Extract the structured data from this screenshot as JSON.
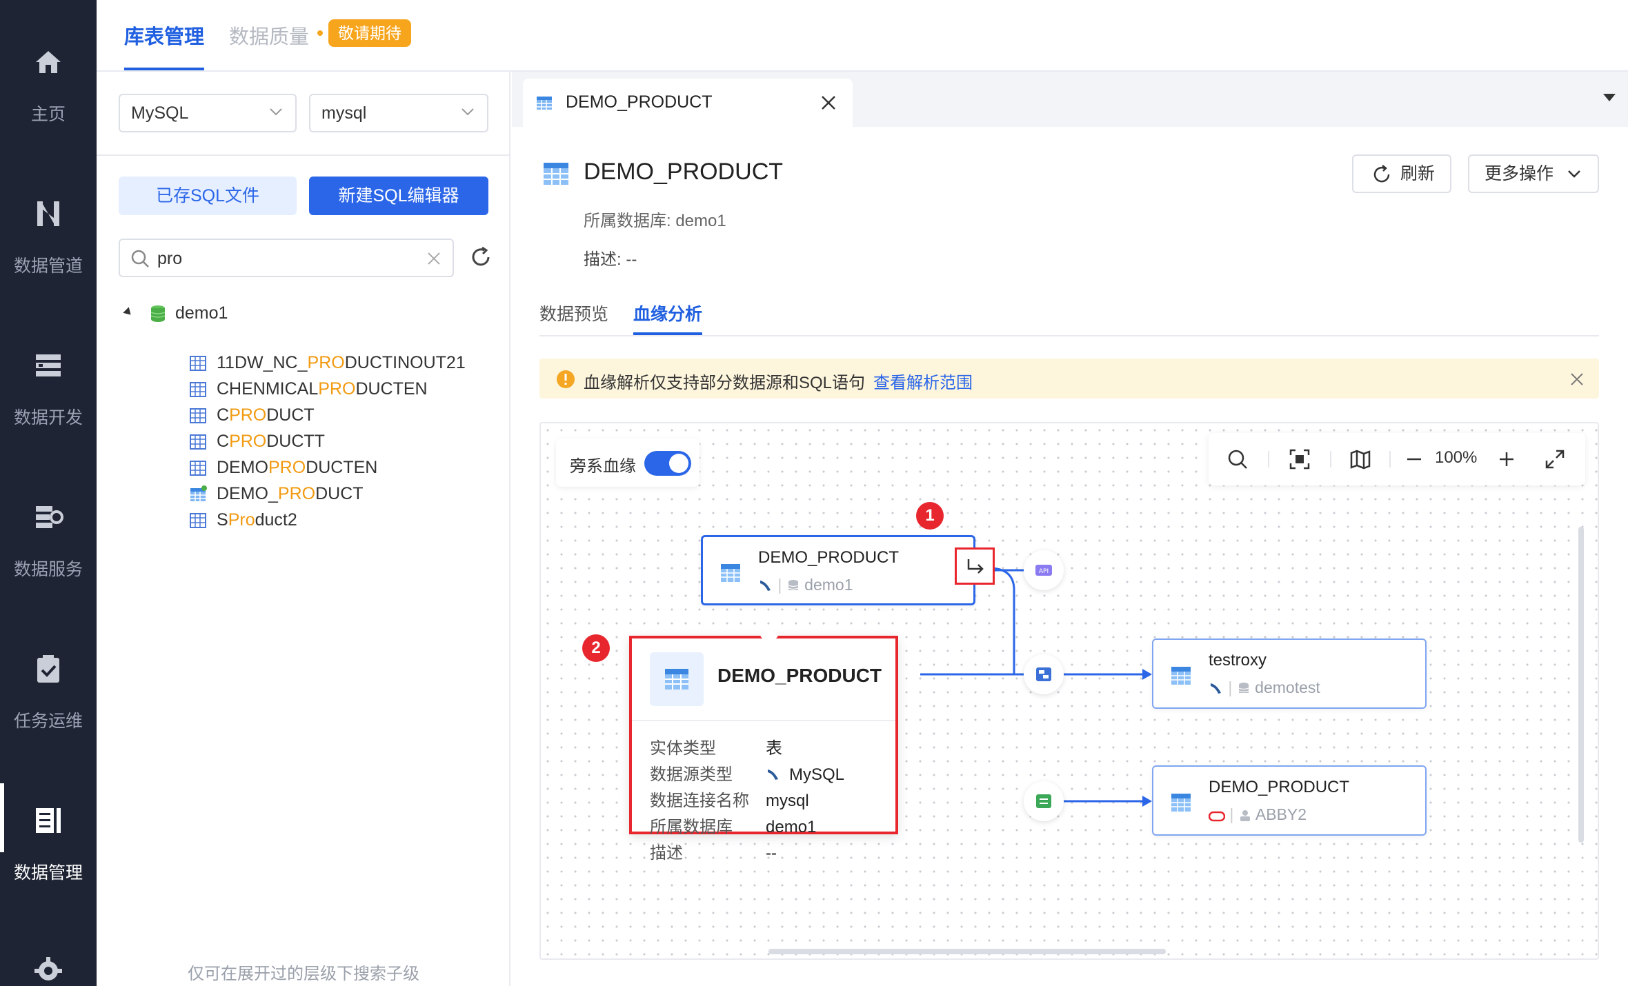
{
  "nav": {
    "items": [
      {
        "label": "主页",
        "icon": "home-icon"
      },
      {
        "label": "数据管道",
        "icon": "pipeline-icon"
      },
      {
        "label": "数据开发",
        "icon": "dev-icon"
      },
      {
        "label": "数据服务",
        "icon": "service-icon"
      },
      {
        "label": "任务运维",
        "icon": "task-icon"
      },
      {
        "label": "数据管理",
        "icon": "data-manage-icon",
        "active": true
      }
    ]
  },
  "top_tabs": {
    "lib": "库表管理",
    "quality": "数据质量",
    "badge": "敬请期待"
  },
  "left": {
    "db_type": "MySQL",
    "connection": "mysql",
    "saved_sql": "已存SQL文件",
    "new_editor": "新建SQL编辑器",
    "search_value": "pro",
    "tree": {
      "root": "demo1",
      "items": [
        {
          "pre": "11DW_NC_",
          "hl": "PRO",
          "post": "DUCTINOUT21"
        },
        {
          "pre": "CHENMICAL",
          "hl": "PRO",
          "post": "DUCTEN"
        },
        {
          "pre": "C",
          "hl": "PRO",
          "post": "DUCT"
        },
        {
          "pre": "C",
          "hl": "PRO",
          "post": "DUCTT"
        },
        {
          "pre": "DEMO",
          "hl": "PRO",
          "post": "DUCTEN"
        },
        {
          "pre": "DEMO_",
          "hl": "PRO",
          "post": "DUCT"
        },
        {
          "pre": "S",
          "hl": "Pro",
          "post": "duct2"
        }
      ]
    },
    "hint": "仅可在展开过的层级下搜索子级"
  },
  "doc_tab": {
    "label": "DEMO_PRODUCT"
  },
  "detail": {
    "title": "DEMO_PRODUCT",
    "database": "所属数据库: demo1",
    "description": "描述: --",
    "refresh": "刷新",
    "more": "更多操作"
  },
  "sub_tabs": {
    "preview": "数据预览",
    "lineage": "血缘分析"
  },
  "notice": {
    "text": "血缘解析仅支持部分数据源和SQL语句",
    "link": "查看解析范围"
  },
  "canvas": {
    "sibling_label": "旁系血缘",
    "sibling_on": true,
    "zoom": "100%",
    "nodes": {
      "main": {
        "title": "DEMO_PRODUCT",
        "db": "demo1"
      },
      "testroxy": {
        "title": "testroxy",
        "db": "demotest"
      },
      "abby": {
        "title": "DEMO_PRODUCT",
        "db": "ABBY2"
      }
    },
    "api_label": "API",
    "badges": [
      "1",
      "2"
    ]
  },
  "popover": {
    "title": "DEMO_PRODUCT",
    "rows": [
      {
        "key": "实体类型",
        "value": "表"
      },
      {
        "key": "数据源类型",
        "value": "MySQL"
      },
      {
        "key": "数据连接名称",
        "value": "mysql"
      },
      {
        "key": "所属数据库",
        "value": "demo1"
      },
      {
        "key": "描述",
        "value": "--"
      }
    ]
  },
  "colors": {
    "primary": "#2b66e8",
    "highlight": "#f29a11",
    "alert": "#e8262d",
    "nav_bg": "#1e2433"
  }
}
